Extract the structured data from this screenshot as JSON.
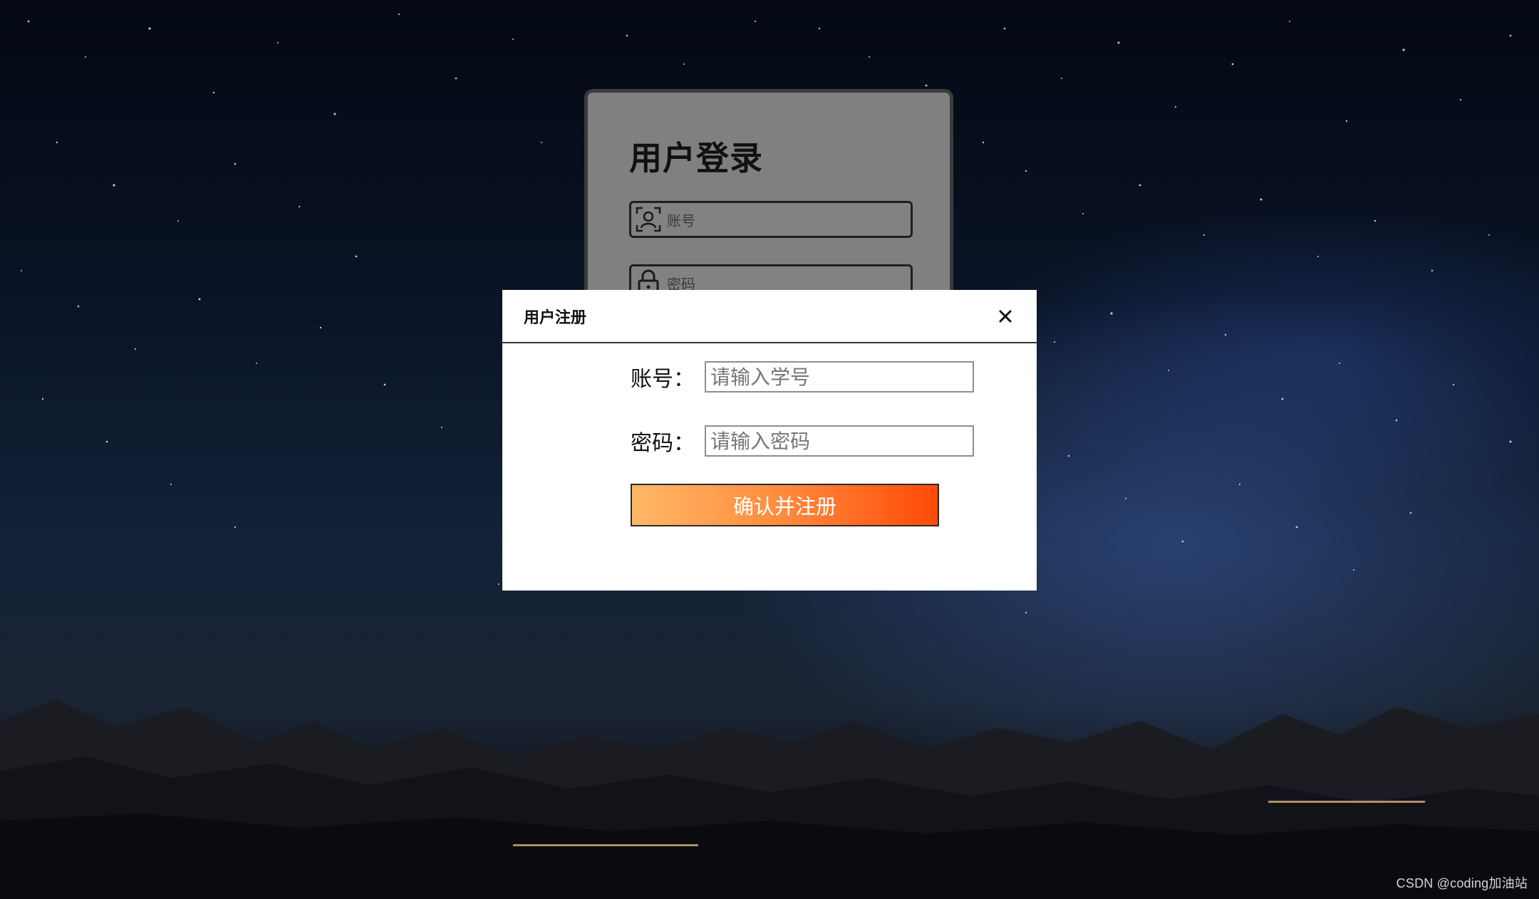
{
  "login": {
    "title": "用户登录",
    "username_placeholder": "账号",
    "password_placeholder": "密码"
  },
  "register_modal": {
    "title": "用户注册",
    "close_symbol": "✕",
    "fields": {
      "username": {
        "label": "账号：",
        "placeholder": "请输入学号",
        "value": ""
      },
      "password": {
        "label": "密码：",
        "placeholder": "请输入密码",
        "value": ""
      }
    },
    "submit_label": "确认并注册"
  },
  "watermark": "CSDN @coding加油站",
  "colors": {
    "login_card_bg": "#808080",
    "modal_bg": "#ffffff",
    "button_gradient_start": "#ffb866",
    "button_gradient_end": "#ff4a08",
    "night_sky": "#0a1426"
  },
  "icons": {
    "username_field": "user-face-icon",
    "password_field": "lock-icon",
    "close": "close-icon"
  }
}
